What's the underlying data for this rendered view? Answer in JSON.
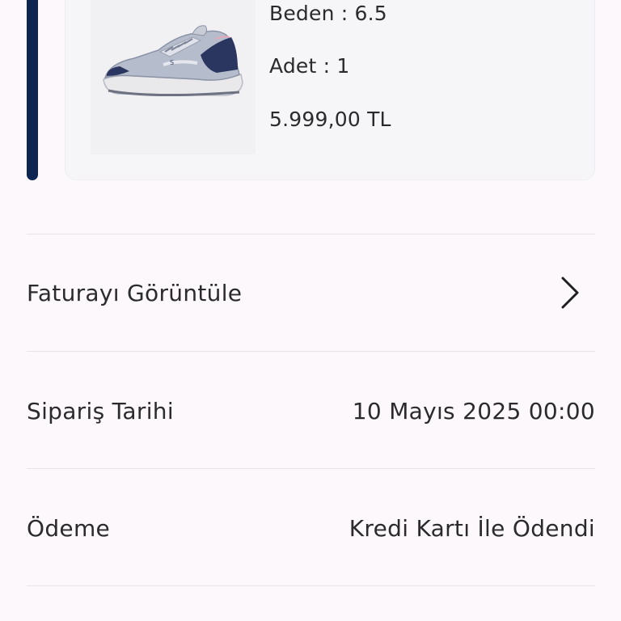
{
  "product": {
    "size_label": "Beden : 6.5",
    "quantity_label": "Adet : 1",
    "price": "5.999,00 TL",
    "image_icon": "sneaker-image"
  },
  "invoice": {
    "label": "Faturayı Görüntüle",
    "icon": "chevron-right-icon"
  },
  "order_date": {
    "label": "Sipariş Tarihi",
    "value": "10 Mayıs 2025 00:00"
  },
  "payment": {
    "label": "Ödeme",
    "value": "Kredi Kartı İle Ödendi"
  },
  "colors": {
    "accent": "#0d2550",
    "background": "#fcf8fc",
    "text": "#2b2b2e"
  }
}
